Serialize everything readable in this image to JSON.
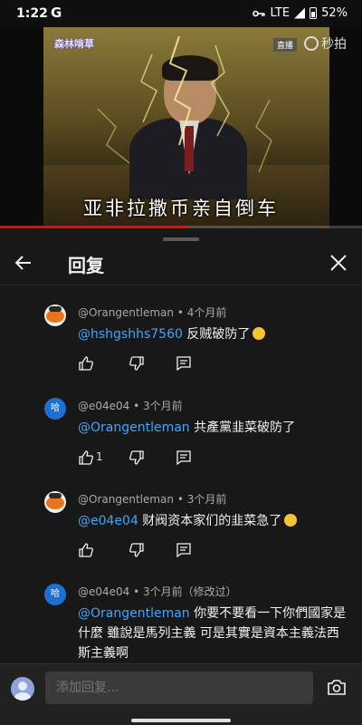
{
  "status_bar": {
    "time": "1:22",
    "app_letter": "G",
    "network": "LTE",
    "battery": "52%"
  },
  "video": {
    "channel_logo": "森林啃草",
    "live_badge": "直播",
    "watermark": "秒拍",
    "subtitle": "亚非拉撒币亲自倒车",
    "progress": 0.52,
    "colors": {
      "progress": "#ff0000"
    }
  },
  "panel": {
    "title": "回复",
    "comments": [
      {
        "avatar": "orange",
        "author": "@Orangentleman",
        "time": "4个月前",
        "edited": "",
        "mention": "@hshgshhs7560",
        "text": " 反贼破防了",
        "emoji": "laughing-emoji",
        "like_count": ""
      },
      {
        "avatar": "blue",
        "avatar_letter": "哈",
        "author": "@e04e04",
        "time": "3个月前",
        "edited": "",
        "mention": "@Orangentleman",
        "text": " 共產黨韭菜破防了",
        "emoji": "",
        "like_count": "1"
      },
      {
        "avatar": "orange",
        "author": "@Orangentleman",
        "time": "3个月前",
        "edited": "",
        "mention": "@e04e04",
        "text": " 财阀资本家们的韭菜急了",
        "emoji": "grinning-emoji",
        "like_count": ""
      },
      {
        "avatar": "blue",
        "avatar_letter": "哈",
        "author": "@e04e04",
        "time": "3个月前",
        "edited": "（修改过）",
        "mention": "@Orangentleman",
        "text": "  你要不要看一下你們國家是什麼 雖說是馬列主義 可是其實是資本主義法西斯主義啊",
        "emoji": "",
        "like_count": ""
      }
    ],
    "reply_placeholder": "添加回复..."
  },
  "colors": {
    "mention": "#3ea6ff",
    "background": "#181818",
    "avatar_blue": "#1d6fd1"
  }
}
